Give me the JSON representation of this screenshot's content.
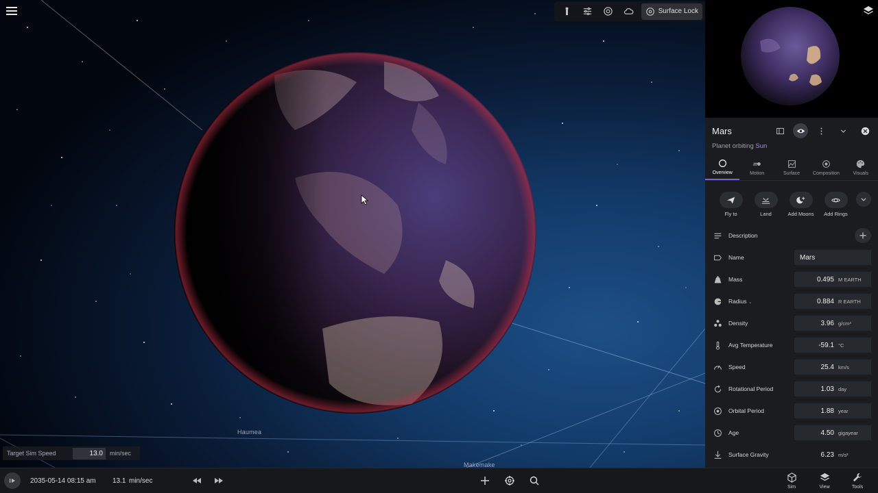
{
  "viewport": {
    "labels": {
      "haumea": "Haumea",
      "makemake": "Makemake"
    },
    "toolbar": {
      "icons": [
        "flashlight-icon",
        "sliders-icon",
        "gravity-icon",
        "cloud-icon"
      ],
      "surface_lock": "Surface Lock"
    },
    "target_speed": {
      "label": "Target Sim Speed",
      "value": "13.0",
      "unit": "min/sec"
    }
  },
  "bottombar": {
    "datetime": "2035-05-14 08:15 am",
    "sim_rate": "13.1",
    "sim_unit": "min/sec",
    "nav": [
      {
        "label": "Sim",
        "icon": "cube-icon"
      },
      {
        "label": "View",
        "icon": "layers-icon"
      },
      {
        "label": "Tools",
        "icon": "wrench-icon"
      }
    ]
  },
  "panel": {
    "title": "Mars",
    "subtitle_prefix": "Planet orbiting ",
    "subtitle_link": "Sun",
    "tabs": [
      "Overview",
      "Motion",
      "Surface",
      "Composition",
      "Visuals"
    ],
    "active_tab": "Overview",
    "actions": [
      "Fly to",
      "Land",
      "Add Moons",
      "Add Rings"
    ],
    "description_label": "Description",
    "properties": [
      {
        "label": "Name",
        "value": "Mars",
        "unit": ""
      },
      {
        "label": "Mass",
        "value": "0.495",
        "unit": "M EARTH"
      },
      {
        "label": "Radius",
        "value": "0.884",
        "unit": "R EARTH"
      },
      {
        "label": "Density",
        "value": "3.96",
        "unit": "g/cm³"
      },
      {
        "label": "Avg Temperature",
        "value": "-59.1",
        "unit": "°C"
      },
      {
        "label": "Speed",
        "value": "25.4",
        "unit": "km/s"
      },
      {
        "label": "Rotational Period",
        "value": "1.03",
        "unit": "day"
      },
      {
        "label": "Orbital Period",
        "value": "1.88",
        "unit": "year"
      },
      {
        "label": "Age",
        "value": "4.50",
        "unit": "gigayear"
      },
      {
        "label": "Surface Gravity",
        "value": "6.23",
        "unit": "m/s²"
      }
    ]
  },
  "colors": {
    "accent": "#7a63d8",
    "link": "#a98be8",
    "panel_bg": "#1a1c20",
    "space": "#123a68"
  }
}
